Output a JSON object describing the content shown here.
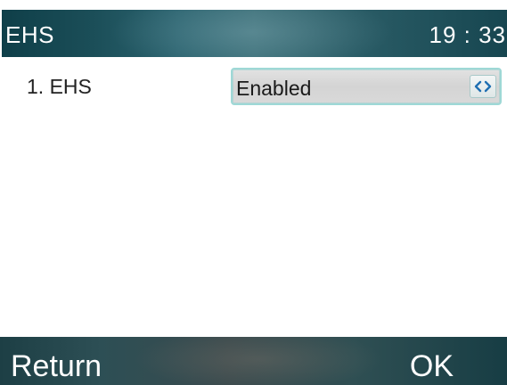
{
  "header": {
    "title": "EHS",
    "time": "19 : 33"
  },
  "list": {
    "items": [
      {
        "label": "1.  EHS",
        "value": "Enabled",
        "control_icon": "left-right-arrows-icon"
      }
    ]
  },
  "softkeys": {
    "left_label": "Return",
    "right_label": "OK"
  },
  "colors": {
    "title_bar": "#2c6470",
    "softkey_bar": "#2d4f55",
    "select_border": "#9ed8d6",
    "arrow_color": "#1f6fb2"
  }
}
